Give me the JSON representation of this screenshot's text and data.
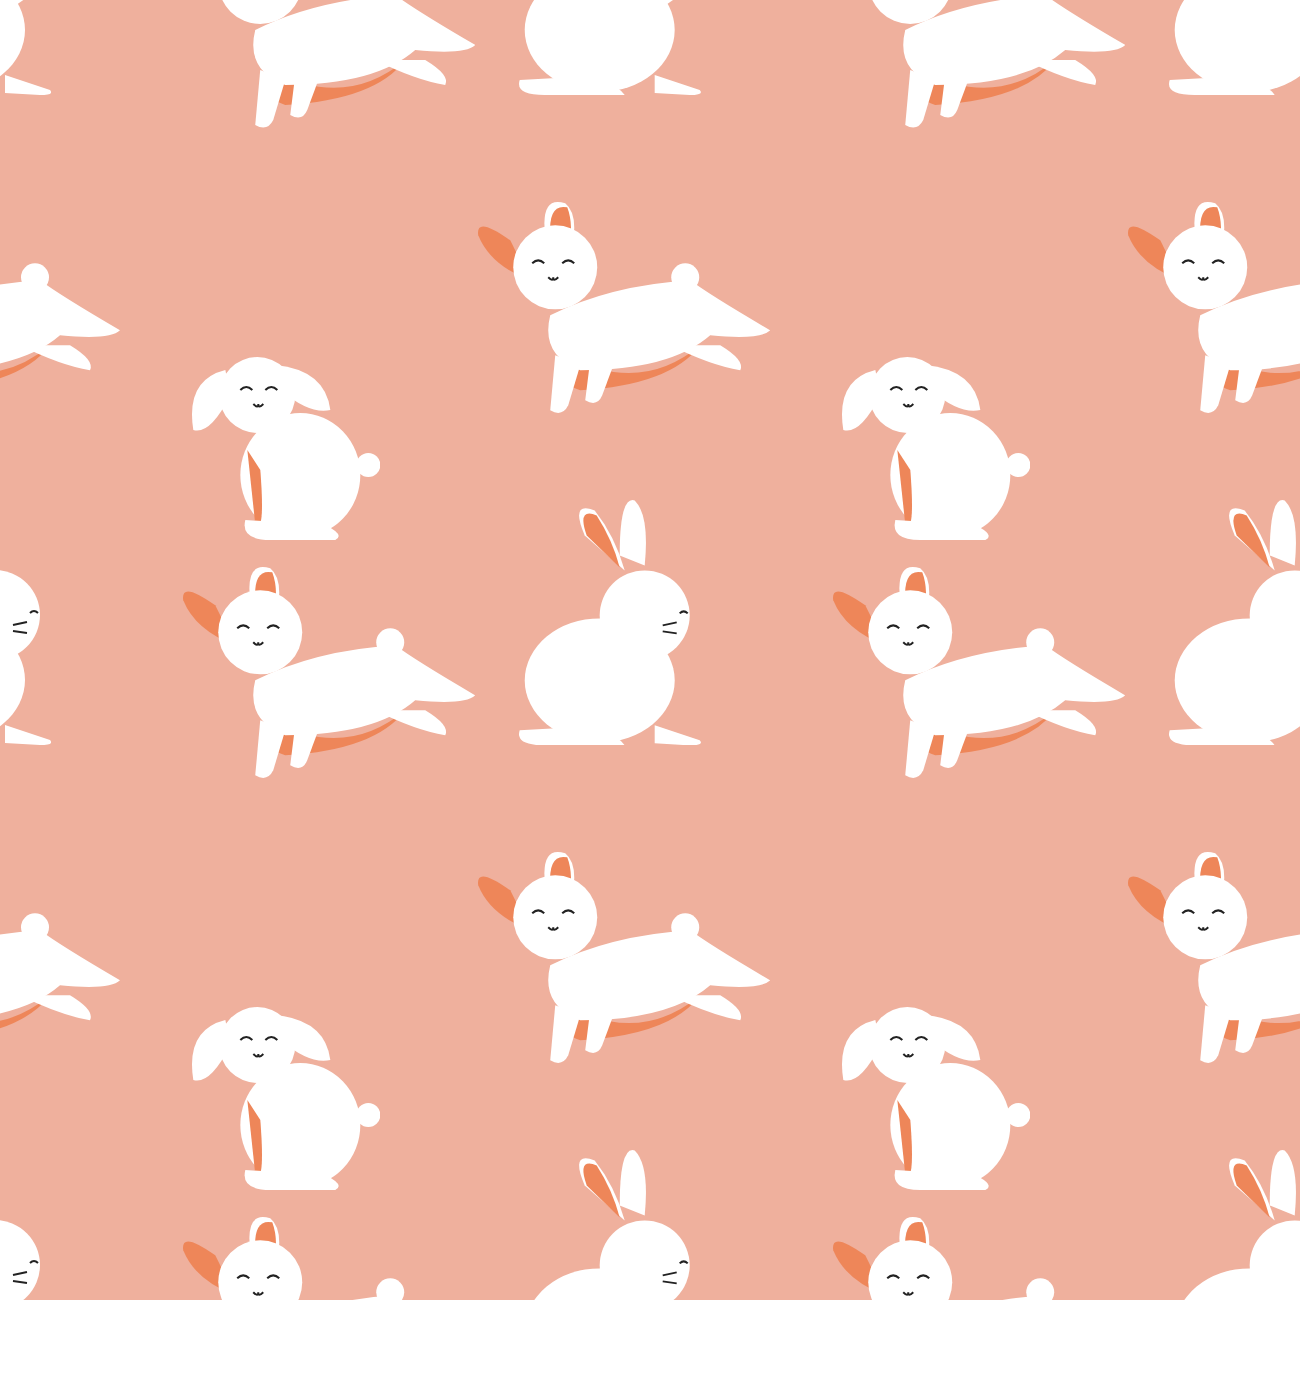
{
  "pattern": {
    "bunnies": [
      {
        "kind": "leaping"
      },
      {
        "kind": "floppy"
      },
      {
        "kind": "sitting"
      },
      {
        "kind": "leaping"
      }
    ]
  }
}
